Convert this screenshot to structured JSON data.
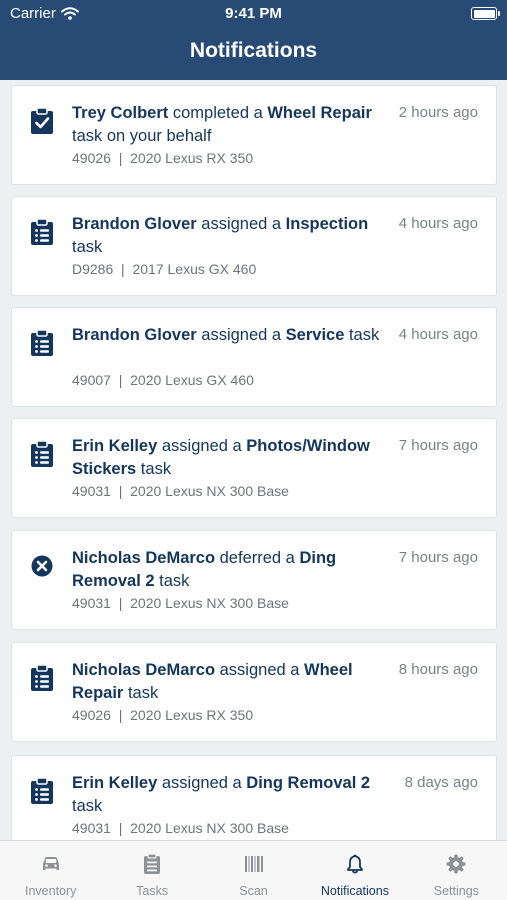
{
  "status_bar": {
    "carrier": "Carrier",
    "time": "9:41 PM"
  },
  "header": {
    "title": "Notifications"
  },
  "notifications": [
    {
      "icon": "clipboard-check-icon",
      "actor": "Trey Colbert",
      "action": " completed a ",
      "task": "Wheel Repair",
      "suffix": " task on your behalf",
      "time": "2 hours ago",
      "stock": "49026",
      "vehicle": "2020 Lexus RX 350"
    },
    {
      "icon": "clipboard-list-icon",
      "actor": "Brandon Glover",
      "action": " assigned a ",
      "task": "Inspection",
      "suffix": " task",
      "time": "4 hours ago",
      "stock": "D9286",
      "vehicle": "2017 Lexus GX 460"
    },
    {
      "icon": "clipboard-list-icon",
      "actor": "Brandon Glover",
      "action": " assigned a ",
      "task": "Service",
      "suffix": " task",
      "time": "4 hours ago",
      "stock": "49007",
      "vehicle": "2020 Lexus GX 460"
    },
    {
      "icon": "clipboard-list-icon",
      "actor": "Erin Kelley",
      "action": " assigned a ",
      "task": "Photos/Window Stickers",
      "suffix": " task",
      "time": "7 hours ago",
      "stock": "49031",
      "vehicle": "2020 Lexus NX 300 Base"
    },
    {
      "icon": "x-circle-icon",
      "actor": "Nicholas DeMarco",
      "action": " deferred a ",
      "task": "Ding Removal 2",
      "suffix": " task",
      "time": "7 hours ago",
      "stock": "49031",
      "vehicle": "2020 Lexus NX 300 Base"
    },
    {
      "icon": "clipboard-list-icon",
      "actor": "Nicholas DeMarco",
      "action": " assigned a ",
      "task": "Wheel Repair",
      "suffix": " task",
      "time": "8 hours ago",
      "stock": "49026",
      "vehicle": "2020 Lexus RX 350"
    },
    {
      "icon": "clipboard-list-icon",
      "actor": "Erin Kelley",
      "action": " assigned a ",
      "task": "Ding Removal 2",
      "suffix": " task",
      "time": "8 days ago",
      "stock": "49031",
      "vehicle": "2020 Lexus NX 300 Base"
    }
  ],
  "meta_separator": "|",
  "tabbar": {
    "tabs": [
      {
        "label": "Inventory",
        "icon": "car-icon",
        "active": false
      },
      {
        "label": "Tasks",
        "icon": "clipboard-icon",
        "active": false
      },
      {
        "label": "Scan",
        "icon": "barcode-icon",
        "active": false
      },
      {
        "label": "Notifications",
        "icon": "bell-icon",
        "active": true
      },
      {
        "label": "Settings",
        "icon": "gear-icon",
        "active": false
      }
    ]
  },
  "colors": {
    "header": "#274b74",
    "accent": "#14365c",
    "inactive": "#8c9196"
  }
}
